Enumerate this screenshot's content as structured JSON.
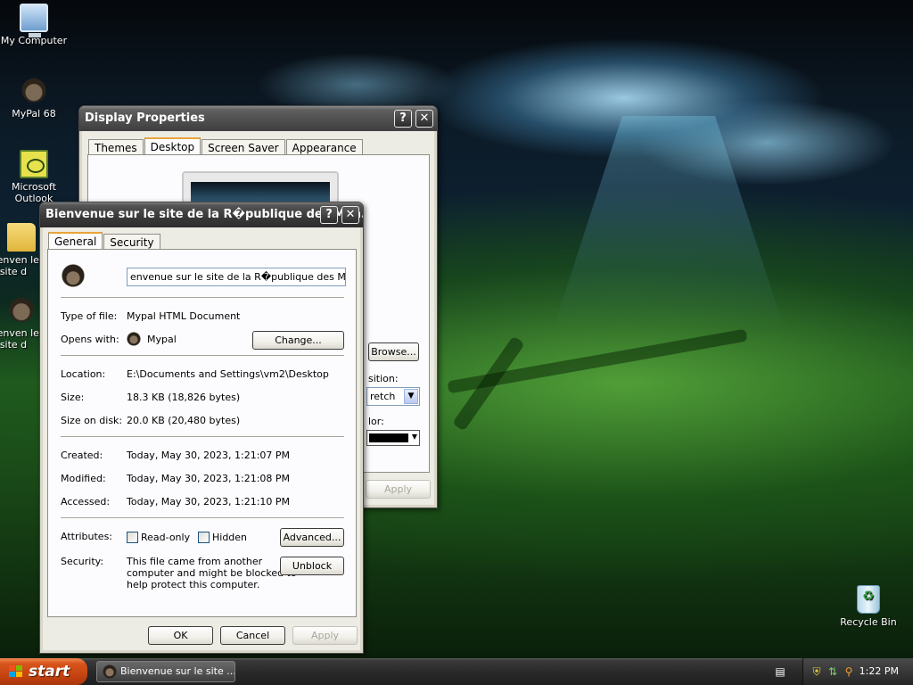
{
  "desktop": {
    "icons": [
      {
        "label": "My Computer",
        "icon": "computer-icon"
      },
      {
        "label": "MyPal 68",
        "icon": "raccoon-icon"
      },
      {
        "label": "Microsoft Outlook",
        "icon": "outlook-icon"
      },
      {
        "label": "Bienven le site d",
        "icon": "folder-icon"
      },
      {
        "label": "Bienven le site d",
        "icon": "raccoon-icon"
      },
      {
        "label": "Recycle Bin",
        "icon": "recycle-bin-icon"
      }
    ]
  },
  "display_properties": {
    "title": "Display Properties",
    "help": "?",
    "close": "✕",
    "tabs": [
      "Themes",
      "Desktop",
      "Screen Saver",
      "Appearance"
    ],
    "selected_tab": "Desktop",
    "browse_label": "Browse...",
    "position_label": "sition:",
    "position_value": "retch",
    "color_label": "lor:",
    "apply_label": "Apply"
  },
  "properties_dialog": {
    "title": "Bienvenue sur le site de la R�publique des Man...",
    "help": "?",
    "close": "✕",
    "tabs": [
      "General",
      "Security"
    ],
    "selected_tab": "General",
    "filename": "envenue sur le site de la R�publique des Mangues",
    "type_label": "Type of file:",
    "type_value": "Mypal HTML Document",
    "opens_label": "Opens with:",
    "opens_value": "Mypal",
    "change_label": "Change...",
    "location_label": "Location:",
    "location_value": "E:\\Documents and Settings\\vm2\\Desktop",
    "size_label": "Size:",
    "size_value": "18.3 KB (18,826 bytes)",
    "size_on_disk_label": "Size on disk:",
    "size_on_disk_value": "20.0 KB (20,480 bytes)",
    "created_label": "Created:",
    "created_value": "Today, May 30, 2023, 1:21:07 PM",
    "modified_label": "Modified:",
    "modified_value": "Today, May 30, 2023, 1:21:08 PM",
    "accessed_label": "Accessed:",
    "accessed_value": "Today, May 30, 2023, 1:21:10 PM",
    "attributes_label": "Attributes:",
    "readonly_label": "Read-only",
    "readonly_checked": false,
    "hidden_label": "Hidden",
    "hidden_checked": false,
    "advanced_label": "Advanced...",
    "security_label": "Security:",
    "security_line1": "This file came from another",
    "security_line2": "computer and might be blocked to",
    "security_line3": "help protect this computer.",
    "unblock_label": "Unblock",
    "ok_label": "OK",
    "cancel_label": "Cancel",
    "apply_label": "Apply"
  },
  "taskbar": {
    "start_label": "start",
    "task_label": "Bienvenue sur le site ...",
    "clock": "1:22 PM"
  }
}
